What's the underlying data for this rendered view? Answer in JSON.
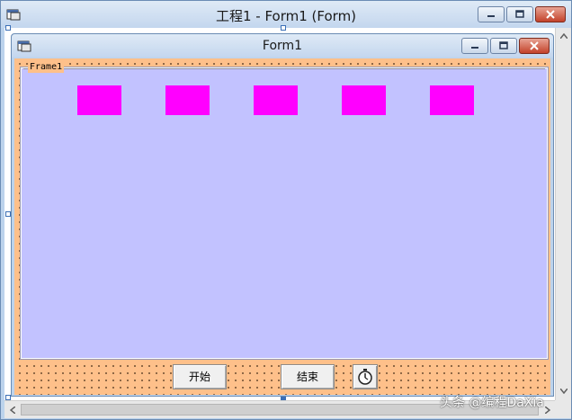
{
  "outer_window": {
    "title": "工程1 - Form1 (Form)",
    "minimize": "minimize",
    "maximize": "maximize",
    "close": "close"
  },
  "form": {
    "title": "Form1",
    "frame": {
      "caption": "Frame1",
      "shapes": [
        "shape",
        "shape",
        "shape",
        "shape",
        "shape"
      ],
      "shape_color": "#ff00ff",
      "background": "#c2c2ff"
    },
    "buttons": {
      "start_label": "开始",
      "end_label": "结束"
    },
    "timer_icon": "stopwatch-icon",
    "background": "#fec08a"
  },
  "watermark": "头条 @编程DaXia",
  "colors": {
    "titlebar": "#c3d6ee",
    "close_button": "#c3422a"
  }
}
